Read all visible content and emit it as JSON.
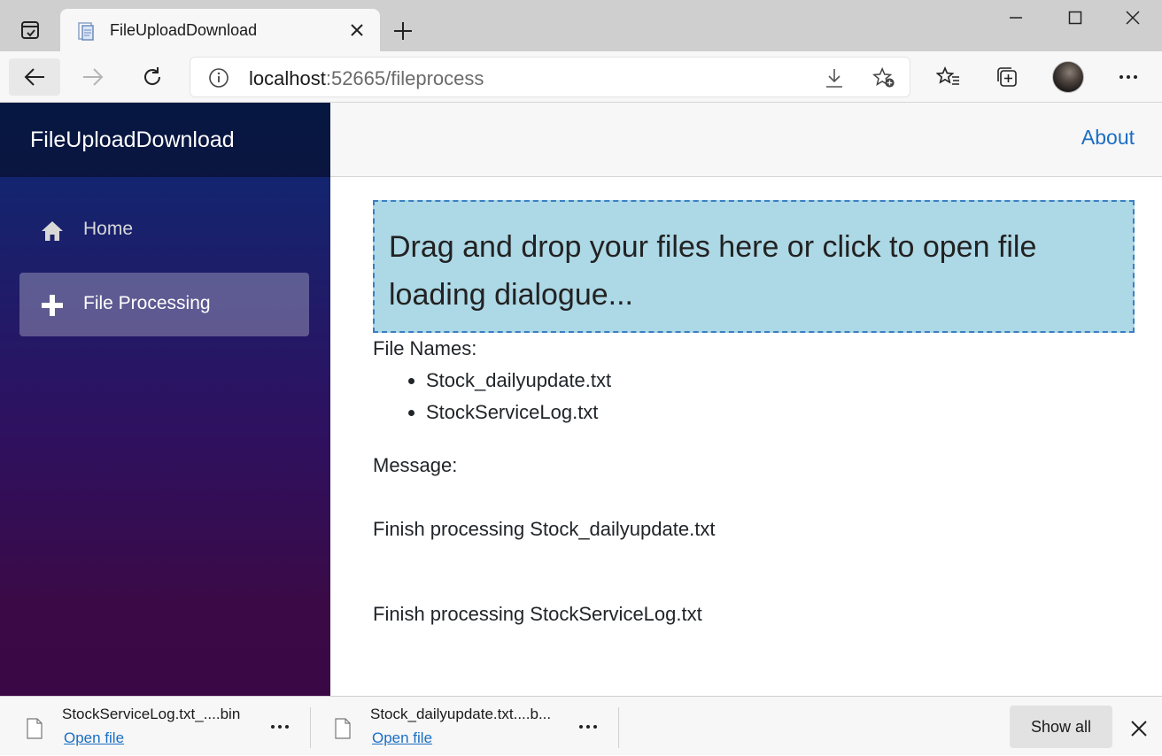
{
  "browser": {
    "tab_title": "FileUploadDownload",
    "url_host": "localhost",
    "url_rest": ":52665/fileprocess"
  },
  "app": {
    "brand": "FileUploadDownload",
    "nav": [
      {
        "label": "Home",
        "icon": "home-icon",
        "active": false
      },
      {
        "label": "File Processing",
        "icon": "plus-icon",
        "active": true
      }
    ],
    "about_link": "About"
  },
  "main": {
    "dropzone_text": "Drag and drop your files here or click to open file loading dialogue...",
    "file_names_label": "File Names:",
    "files": [
      "Stock_dailyupdate.txt",
      "StockServiceLog.txt"
    ],
    "message_label": "Message:",
    "messages": [
      "Finish processing Stock_dailyupdate.txt",
      "Finish processing StockServiceLog.txt"
    ]
  },
  "downloads": {
    "items": [
      {
        "name": "StockServiceLog.txt_....bin",
        "action": "Open file"
      },
      {
        "name": "Stock_dailyupdate.txt....b...",
        "action": "Open file"
      }
    ],
    "show_all": "Show all"
  },
  "colors": {
    "accent": "#1b6ec2",
    "dropzone_bg": "#add8e6",
    "sidebar_top": "#0b2a72",
    "sidebar_bottom": "#3a0844"
  }
}
